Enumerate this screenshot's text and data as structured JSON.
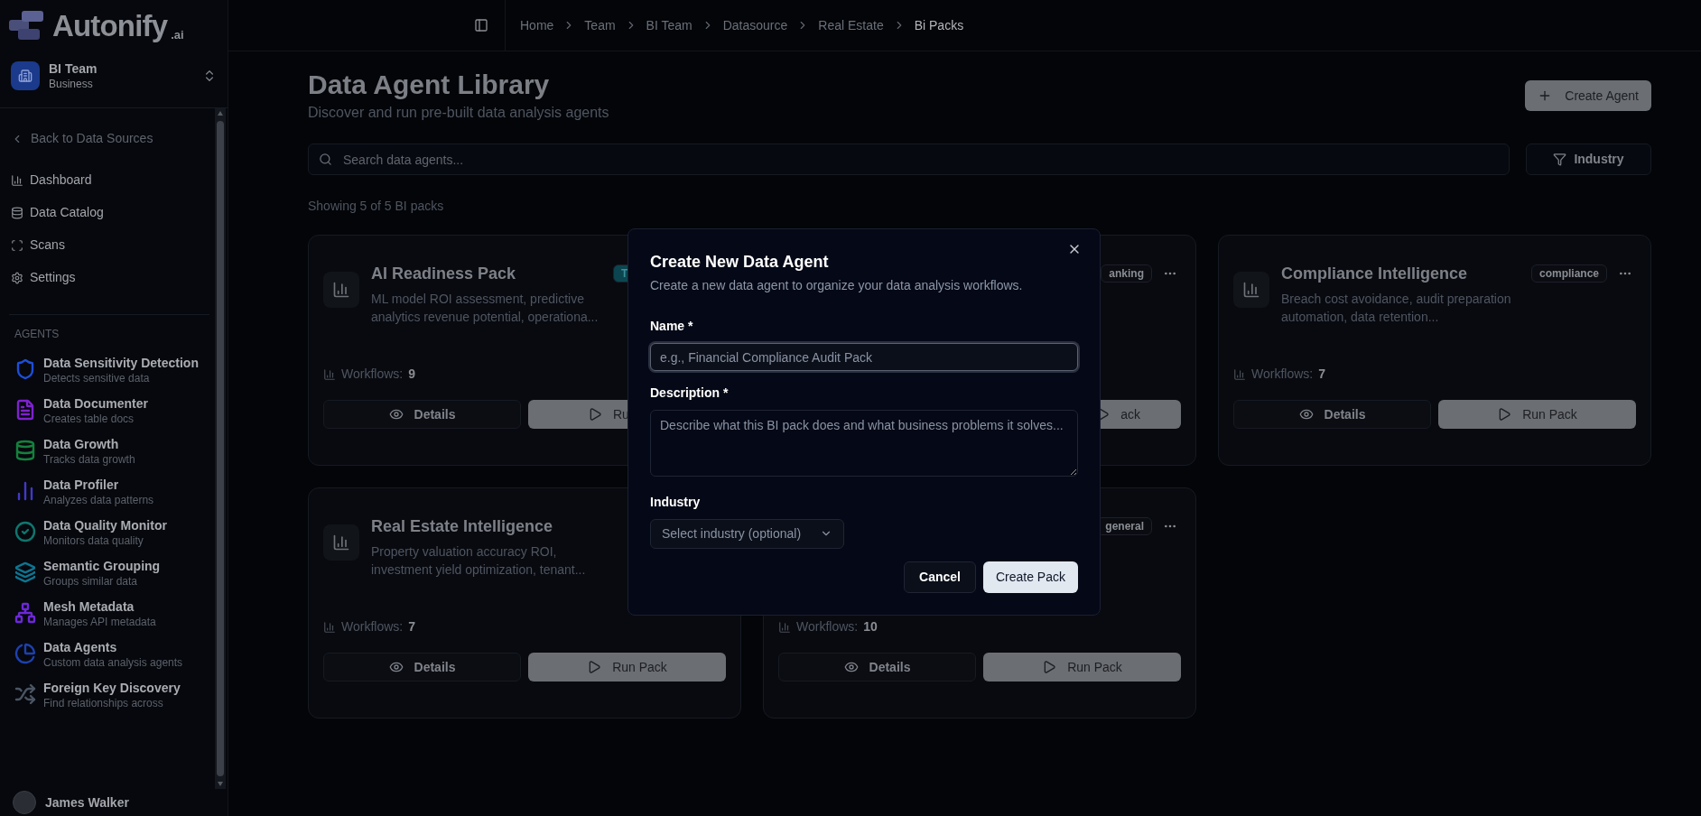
{
  "sidebar": {
    "logo": {
      "name": "Autonify",
      "suffix": ".ai"
    },
    "team": {
      "name": "BI Team",
      "plan": "Business"
    },
    "back_link": "Back to Data Sources",
    "nav": [
      "Dashboard",
      "Data Catalog",
      "Scans",
      "Settings"
    ],
    "agents_heading": "AGENTS",
    "agents": [
      {
        "title": "Data Sensitivity Detection",
        "subtitle": "Detects sensitive data",
        "color": "#1d4ed8"
      },
      {
        "title": "Data Documenter",
        "subtitle": "Creates table docs",
        "color": "#7e22ce"
      },
      {
        "title": "Data Growth",
        "subtitle": "Tracks data growth",
        "color": "#15803d"
      },
      {
        "title": "Data Profiler",
        "subtitle": "Analyzes data patterns",
        "color": "#4338ca"
      },
      {
        "title": "Data Quality Monitor",
        "subtitle": "Monitors data quality",
        "color": "#0f766e"
      },
      {
        "title": "Semantic Grouping",
        "subtitle": "Groups similar data",
        "color": "#0e7490"
      },
      {
        "title": "Mesh Metadata",
        "subtitle": "Manages API metadata",
        "color": "#6d28d9"
      },
      {
        "title": "Data Agents",
        "subtitle": "Custom data analysis agents",
        "color": "#1e40af"
      },
      {
        "title": "Foreign Key Discovery",
        "subtitle": "Find relationships across",
        "color": "#4b5563"
      }
    ],
    "user": "James Walker"
  },
  "breadcrumbs": [
    {
      "label": "Home",
      "selected": false
    },
    {
      "label": "Team",
      "selected": false
    },
    {
      "label": "BI Team",
      "selected": false
    },
    {
      "label": "Datasource",
      "selected": false
    },
    {
      "label": "Real Estate",
      "selected": false
    },
    {
      "label": "Bi Packs",
      "selected": true
    }
  ],
  "page": {
    "title": "Data Agent Library",
    "subtitle": "Discover and run pre-built data analysis agents",
    "create_button": "Create Agent",
    "search": {
      "placeholder": "Search data agents..."
    },
    "filter_button": "Industry",
    "count": "Showing 5 of 5 BI packs"
  },
  "cards": [
    {
      "title": "AI Readiness Pack",
      "description": "ML model ROI assessment, predictive analytics revenue potential, operationa...",
      "tag": {
        "text": "T",
        "color": "#0b4650"
      },
      "menu": false,
      "workflows_label": "Workflows:",
      "workflows": "9",
      "details": "Details",
      "run": {
        "label": "Ru"
      }
    },
    {
      "tag": {
        "text": "anking",
        "color": "#0a0c12"
      },
      "menu": true,
      "run": {
        "label": "ack"
      }
    },
    {
      "title": "Compliance Intelligence",
      "description": "Breach cost avoidance, audit preparation automation, data retention...",
      "tag": {
        "text": "compliance",
        "color": "#0a0c12"
      },
      "menu": true,
      "workflows_label": "Workflows:",
      "workflows": "7",
      "details": "Details",
      "run": {
        "label": "Run Pack"
      }
    },
    {
      "title": "Real Estate Intelligence",
      "description": "Property valuation accuracy ROI, investment yield optimization, tenant...",
      "menu": false,
      "workflows_label": "Workflows:",
      "workflows": "7",
      "details": "Details",
      "run": {
        "label": "Run Pack"
      }
    },
    {
      "tag": {
        "text": "general",
        "color": "#0a0c12"
      },
      "menu": true,
      "workflows_label": "Workflows:",
      "workflows": "10",
      "details": "Details",
      "run": {
        "label": "Run Pack"
      }
    }
  ],
  "dialog": {
    "title": "Create New Data Agent",
    "subtitle": "Create a new data agent to organize your data analysis workflows.",
    "name_label": "Name *",
    "name_placeholder": "e.g., Financial Compliance Audit Pack",
    "description_label": "Description *",
    "description_placeholder": "Describe what this BI pack does and what business problems it solves...",
    "industry_label": "Industry",
    "industry_placeholder": "Select industry (optional)",
    "cancel": "Cancel",
    "submit": "Create Pack"
  }
}
